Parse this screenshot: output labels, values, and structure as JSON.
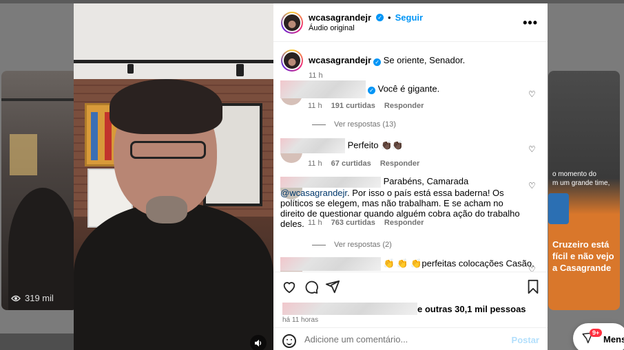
{
  "background": {
    "left_card": {
      "views": "319 mil"
    },
    "right_card": {
      "text_top": "o momento do\nm um grande time,",
      "text_bottom": "Cruzeiro está\nfícil e não vejo\na Casagrande"
    }
  },
  "post": {
    "header": {
      "username": "wcasagrandejr",
      "verified": true,
      "separator": "•",
      "follow_label": "Seguir",
      "audio_label": "Áudio original",
      "more_icon": "more-horizontal-icon"
    },
    "caption": {
      "username": "wcasagrandejr",
      "text": "Se oriente, Senador.",
      "time": "11 h"
    },
    "comments": [
      {
        "text": "Você é gigante.",
        "time": "11 h",
        "likes": "191 curtidas",
        "reply_label": "Responder",
        "view_replies": "Ver respostas (13)",
        "verified": true
      },
      {
        "text": "Perfeito 👏🏿👏🏿",
        "time": "11 h",
        "likes": "67 curtidas",
        "reply_label": "Responder"
      },
      {
        "text_prefix": "Parabéns, Camarada ",
        "mention": "@wcasagrandejr",
        "text_suffix": ". Por isso o país está essa baderna! Os políticos se elegem, mas não trabalham. E se acham no direito de questionar quando alguém cobra ação do trabalho deles.",
        "time": "11 h",
        "likes": "763 curtidas",
        "reply_label": "Responder",
        "view_replies": "Ver respostas (2)"
      },
      {
        "text": "👏 👏 👏perfeitas colocações Casão."
      }
    ],
    "actions": {
      "icons": [
        "heart-icon",
        "comment-icon",
        "share-icon",
        "bookmark-icon"
      ],
      "likes_suffix": "e outras 30,1 mil pessoas",
      "ago": "há 11 horas"
    },
    "add_comment": {
      "placeholder": "Adicione um comentário...",
      "post_label": "Postar"
    }
  },
  "messages_fab": {
    "badge": "9+",
    "label": "Mens"
  },
  "colors": {
    "accent": "#0095f6",
    "muted": "#737373",
    "mention": "#00376b",
    "badge": "#ff3040"
  }
}
